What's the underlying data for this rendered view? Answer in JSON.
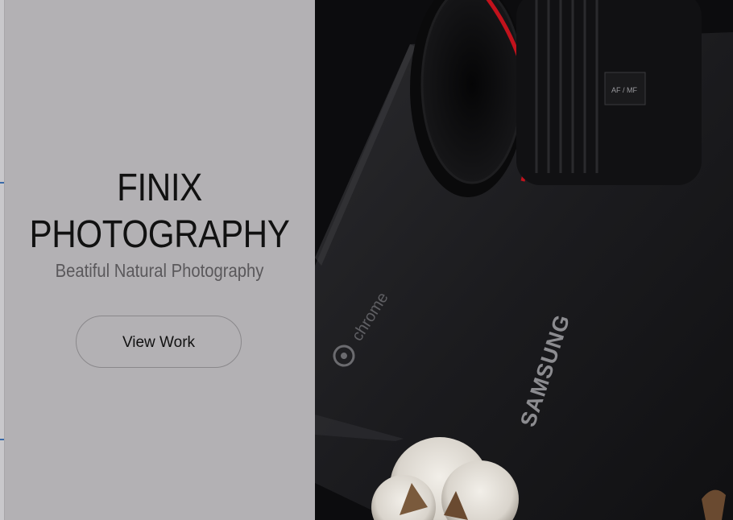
{
  "hero": {
    "title_line1": "FINIX",
    "title_line2": "PHOTOGRAPHY",
    "subtitle": "Beatiful Natural Photography",
    "cta_label": "View Work"
  },
  "photo": {
    "laptop_brand": "SAMSUNG",
    "laptop_os": "chrome",
    "lens_text": "AF / MF"
  }
}
